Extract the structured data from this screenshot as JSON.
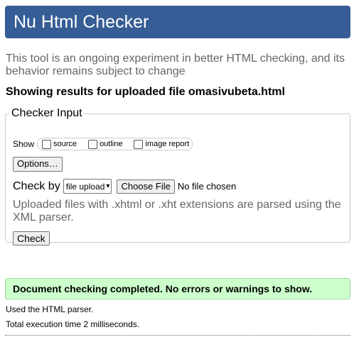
{
  "header": {
    "title": "Nu Html Checker"
  },
  "intro": "This tool is an ongoing experiment in better HTML checking, and its behavior remains subject to change",
  "results_heading": "Showing results for uploaded file omasivubeta.html",
  "checker_input": {
    "legend": "Checker Input",
    "show_label": "Show",
    "show_options": [
      {
        "label": "source",
        "checked": false
      },
      {
        "label": "outline",
        "checked": false
      },
      {
        "label": "image report",
        "checked": false
      }
    ],
    "options_button": "Options…",
    "check_by_label": "Check by",
    "check_by_selected": "file upload",
    "choose_file_button": "Choose File",
    "no_file_text": "No file chosen",
    "note": "Uploaded files with .xhtml or .xht extensions are parsed using the XML parser.",
    "check_button": "Check"
  },
  "result": {
    "success_message": "Document checking completed. No errors or warnings to show.",
    "parser_note": "Used the HTML parser.",
    "timing_note": "Total execution time 2 milliseconds."
  },
  "colors": {
    "banner": "#365d95",
    "success_bg": "#ccffcc",
    "muted_text": "#666666"
  }
}
